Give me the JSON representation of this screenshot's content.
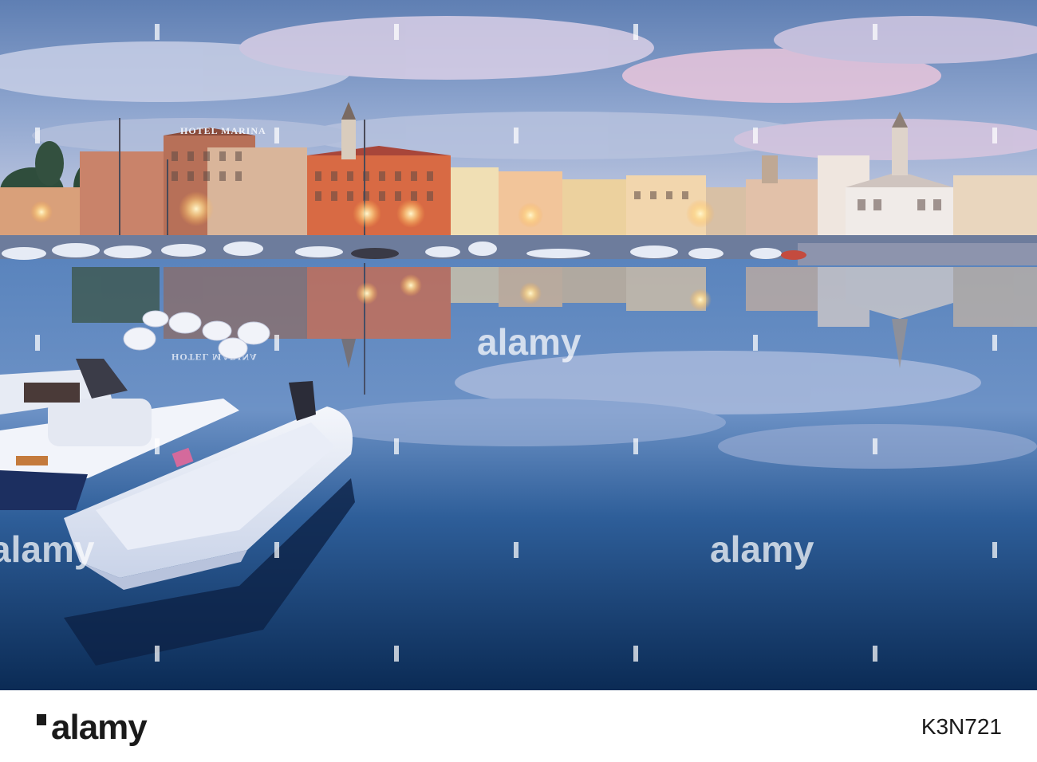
{
  "photo": {
    "hotel_sign": "HOTEL MARINA",
    "hotel_sign_reflection": "HOTEL MARINA",
    "colors": {
      "sky_top": "#6f8fbf",
      "sky_pink": "#e8bfd6",
      "water_top": "#4a79b5",
      "water_bottom": "#0d2f5a",
      "facade_orange": "#d86a44",
      "facade_cream": "#f2d6ad",
      "lamp": "#fff3c0"
    }
  },
  "watermark": {
    "text": "alamy"
  },
  "footer": {
    "logo": "alamy",
    "image_id": "K3N721"
  }
}
